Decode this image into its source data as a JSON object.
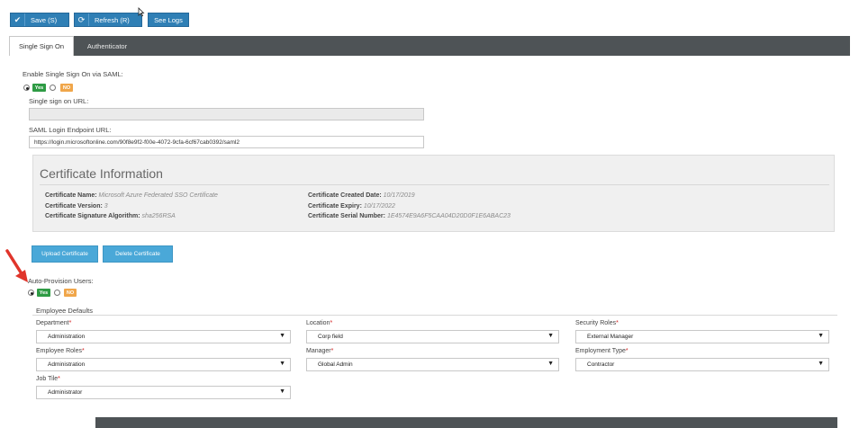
{
  "toolbar": {
    "save_label": "Save (S)",
    "refresh_label": "Refresh (R)",
    "see_logs_label": "See Logs"
  },
  "tabs": [
    {
      "label": "Single Sign On"
    },
    {
      "label": "Authenticator"
    }
  ],
  "sso": {
    "enable_label": "Enable Single Sign On via SAML:",
    "yes": "Yes",
    "no": "NO",
    "url_label": "Single sign on URL:",
    "saml_label": "SAML Login Endpoint URL:",
    "saml_value": "https://login.microsoftonline.com/90f8e9f2-f00e-4072-9cfa-6cf67cab0392/saml2"
  },
  "certificate": {
    "title": "Certificate Information",
    "name_key": "Certificate Name:",
    "name_val": "Microsoft Azure Federated SSO Certificate",
    "version_key": "Certificate Version:",
    "version_val": "3",
    "algo_key": "Certificate Signature Algorithm:",
    "algo_val": "sha256RSA",
    "created_key": "Certificate Created Date:",
    "created_val": "10/17/2019",
    "expiry_key": "Certificate Expiry:",
    "expiry_val": "10/17/2022",
    "serial_key": "Certificate Serial Number:",
    "serial_val": "1E4574E9A6F5CAA04D20D0F1E6ABAC23"
  },
  "buttons": {
    "upload": "Upload Certificate",
    "delete": "Delete Certificate"
  },
  "provision": {
    "label": "Auto-Provision Users:",
    "yes": "Yes",
    "no": "NO",
    "defaults_label": "Employee Defaults"
  },
  "fields": {
    "department": {
      "label": "Department",
      "value": "Administration"
    },
    "location": {
      "label": "Location",
      "value": "Corp field"
    },
    "security_roles": {
      "label": "Security Roles",
      "value": "External Manager"
    },
    "employee_roles": {
      "label": "Employee Roles",
      "value": "Administration"
    },
    "manager": {
      "label": "Manager",
      "value": "Global Admin"
    },
    "employment_type": {
      "label": "Employment Type",
      "value": "Contractor"
    },
    "job_title": {
      "label": "Job Tile",
      "value": "Administrator"
    },
    "required_mark": "*",
    "caret": "▼"
  },
  "colors": {
    "primary": "#2f7fb5",
    "accent_button": "#4aa8d8",
    "tab_bar": "#4e5356",
    "yes_badge": "#2e9b44",
    "no_badge": "#f0a64a",
    "required": "#d42020",
    "annotation_arrow": "#e0352b"
  }
}
